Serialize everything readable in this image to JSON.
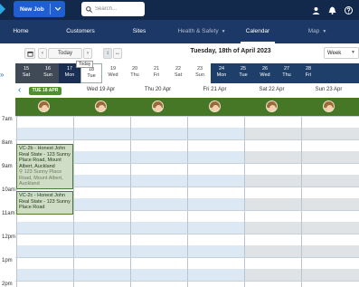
{
  "topbar": {
    "new_job_label": "New Job",
    "search_placeholder": "Search..."
  },
  "nav": {
    "items": [
      {
        "label": "Home"
      },
      {
        "label": "Customers"
      },
      {
        "label": "Sites"
      },
      {
        "label": "Health & Safety"
      },
      {
        "label": "Calendar"
      },
      {
        "label": "Map"
      }
    ]
  },
  "toolbar": {
    "today_label": "Today",
    "current_date": "Tuesday, 18th of April 2023",
    "view": "Week"
  },
  "today_flag": "Today",
  "date_strip": [
    {
      "num": "15",
      "day": "Sat"
    },
    {
      "num": "16",
      "day": "Sun"
    },
    {
      "num": "17",
      "day": "Mon"
    },
    {
      "num": "18",
      "day": "Tue"
    },
    {
      "num": "19",
      "day": "Wed"
    },
    {
      "num": "20",
      "day": "Thu"
    },
    {
      "num": "21",
      "day": "Fri"
    },
    {
      "num": "22",
      "day": "Sat"
    },
    {
      "num": "23",
      "day": "Sun"
    },
    {
      "num": "24",
      "day": "Mon"
    },
    {
      "num": "25",
      "day": "Tue"
    },
    {
      "num": "26",
      "day": "Wed"
    },
    {
      "num": "27",
      "day": "Thu"
    },
    {
      "num": "28",
      "day": "Fri"
    }
  ],
  "columns": [
    {
      "label": "TUE 18 APR"
    },
    {
      "label": "Wed 19 Apr"
    },
    {
      "label": "Thu 20 Apr"
    },
    {
      "label": "Fri 21 Apr"
    },
    {
      "label": "Sat 22 Apr"
    },
    {
      "label": "Sun 23 Apr"
    }
  ],
  "times": [
    "7am",
    "8am",
    "9am",
    "10am",
    "11am",
    "12pm",
    "1pm",
    "2pm"
  ],
  "events": [
    {
      "title": "VC-2b - Honest John Real State - 123 Sunny Place Road, Mount Albert, Auckland",
      "address": "123 Sunny Place Road, Mount Albert, Auckland"
    },
    {
      "title": "VC-2c - Honest John Real State - 123 Sunny Place Road",
      "address": ""
    }
  ],
  "colors": {
    "topbar": "#13294b",
    "nav": "#1b3866",
    "accent": "#1f5fd0",
    "staff_row": "#467727",
    "event_bg": "#cfdcc6",
    "weekday_stripe": "#dce9f5",
    "weekend_stripe": "#dfe3e6"
  }
}
